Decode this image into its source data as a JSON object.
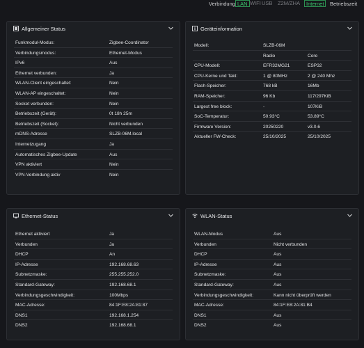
{
  "topbar": {
    "verbindung_label": "Verbindung",
    "chips": [
      "LAN",
      "WIFI",
      "USB",
      "Z2M/ZHA",
      "Internet"
    ],
    "betriebszeit": "Betriebszeit"
  },
  "status_panel": {
    "title": "Allgemeiner Status",
    "rows": [
      {
        "k": "Funkmodul-Modus:",
        "v": "Zigbee-Coordinator"
      },
      {
        "k": "Verbindungsmodus:",
        "v": "Ethernet-Modus"
      },
      {
        "k": "IPv6",
        "v": "Aus"
      },
      {
        "k": "Ethernet verbunden:",
        "v": "Ja"
      },
      {
        "k": "WLAN-Client eingeschaltet:",
        "v": "Nein"
      },
      {
        "k": "WLAN-AP eingeschaltet:",
        "v": "Nein"
      },
      {
        "k": "Socket verbunden:",
        "v": "Nein"
      },
      {
        "k": "Betriebszeit (Gerät):",
        "v": "0t 18h 25m"
      },
      {
        "k": "Betriebszeit (Socket):",
        "v": "Nicht verbunden"
      },
      {
        "k": "mDNS-Adresse",
        "v": "SLZB-06M.local"
      },
      {
        "k": "Internetzugang",
        "v": "Ja"
      },
      {
        "k": "Automatisches Zigbee-Update",
        "v": "Aus"
      },
      {
        "k": "VPN aktiviert",
        "v": "Nein"
      },
      {
        "k": "VPN-Verbindung aktiv",
        "v": "Nein"
      }
    ]
  },
  "device_panel": {
    "title": "Geräteinformation",
    "rows": [
      {
        "k": "Modell:",
        "v": "SLZB-06M",
        "v2": ""
      },
      {
        "k": "",
        "v": "Radio",
        "v2": "Core"
      },
      {
        "k": "CPU-Modell:",
        "v": "EFR32MG21",
        "v2": "ESP32"
      },
      {
        "k": "CPU-Kerne und Takt:",
        "v": "1 @ 80MHz",
        "v2": "2 @ 240 Mhz"
      },
      {
        "k": "Flash-Speicher:",
        "v": "768 kB",
        "v2": "16Mb"
      },
      {
        "k": "RAM-Speicher:",
        "v": "96 Kb",
        "v2": "117/297KiB"
      },
      {
        "k": "Largest free block:",
        "v": "-",
        "v2": "107KiB"
      },
      {
        "k": "SoC-Temperatur:",
        "v": "50.93°C",
        "v2": "53.89°C"
      },
      {
        "k": "Firmware Version:",
        "v": "20250220",
        "v2": "v3.0.6"
      },
      {
        "k": "Aktueller FW-Check:",
        "v": "25/10/2025",
        "v2": "25/10/2025"
      }
    ]
  },
  "ethernet_panel": {
    "title": "Ethernet-Status",
    "rows": [
      {
        "k": "Ethernet aktiviert",
        "v": "Ja"
      },
      {
        "k": "Verbunden",
        "v": "Ja"
      },
      {
        "k": "DHCP",
        "v": "An"
      },
      {
        "k": "IP-Adresse",
        "v": "192.168.68.63"
      },
      {
        "k": "Subnetzmaske:",
        "v": "255.255.252.0"
      },
      {
        "k": "Standard-Gateway:",
        "v": "192.168.68.1"
      },
      {
        "k": "Verbindungsgeschwindigkeit:",
        "v": "100Mbps"
      },
      {
        "k": "MAC-Adresse:",
        "v": "84:1F:E8:2A:81:87"
      },
      {
        "k": "DNS1",
        "v": "192.168.1.254"
      },
      {
        "k": "DNS2",
        "v": "192.168.68.1"
      }
    ]
  },
  "wlan_panel": {
    "title": "WLAN-Status",
    "rows": [
      {
        "k": "WLAN-Modus",
        "v": "Aus"
      },
      {
        "k": "Verbunden",
        "v": "Nicht verbunden"
      },
      {
        "k": "DHCP",
        "v": "Aus"
      },
      {
        "k": "IP-Adresse",
        "v": "Aus"
      },
      {
        "k": "Subnetzmaske:",
        "v": "Aus"
      },
      {
        "k": "Standard-Gateway:",
        "v": "Aus"
      },
      {
        "k": "Verbindungsgeschwindigkeit:",
        "v": "Kann nicht überprüft werden"
      },
      {
        "k": "MAC-Adresse:",
        "v": "84:1F:E8:2A:81:B4"
      },
      {
        "k": "DNS1",
        "v": "Aus"
      },
      {
        "k": "DNS2",
        "v": "Aus"
      }
    ]
  },
  "icons": {
    "status": "status-icon",
    "device": "info-icon",
    "ethernet": "ethernet-icon",
    "wlan": "wifi-icon",
    "chevron": "chevron-down-icon"
  },
  "colors": {
    "background": "#16171b",
    "panel": "#1d1f23",
    "accent_green": "#3cc46c",
    "divider": "#2e3035"
  }
}
